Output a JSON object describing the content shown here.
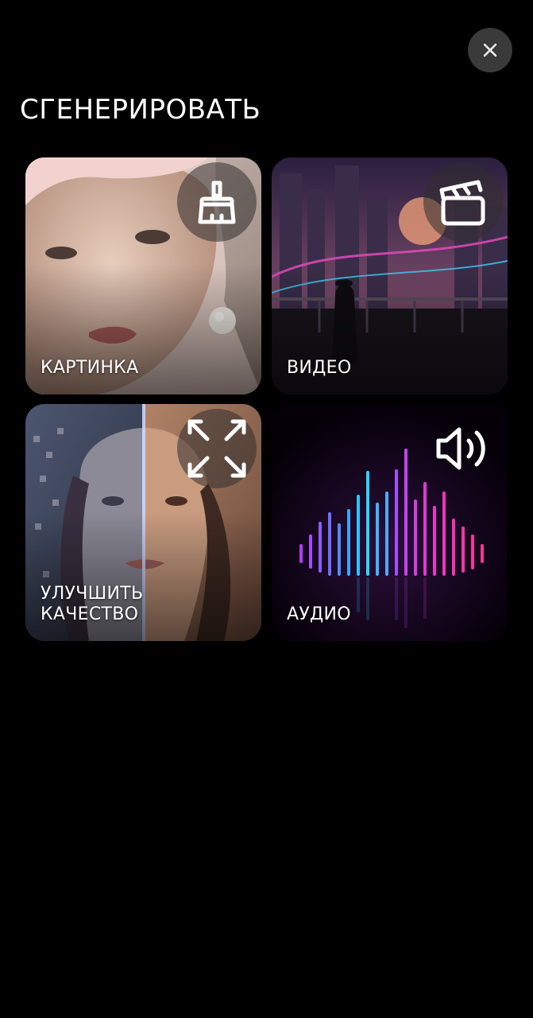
{
  "header": {
    "title": "СГЕНЕРИРОВАТЬ",
    "close_icon": "close-icon"
  },
  "cards": [
    {
      "id": "image",
      "label": "КАРТИНКА",
      "icon": "broom-icon"
    },
    {
      "id": "video",
      "label": "ВИДЕО",
      "icon": "clapperboard-icon"
    },
    {
      "id": "upscale",
      "label_lines": [
        "УЛУЧШИТЬ",
        "КАЧЕСТВО"
      ],
      "icon": "expand-arrows-icon"
    },
    {
      "id": "audio",
      "label": "АУДИО",
      "icon": "speaker-icon"
    }
  ],
  "colors": {
    "background": "#000000",
    "close_button": "#3a3a3a",
    "text": "#ffffff"
  }
}
